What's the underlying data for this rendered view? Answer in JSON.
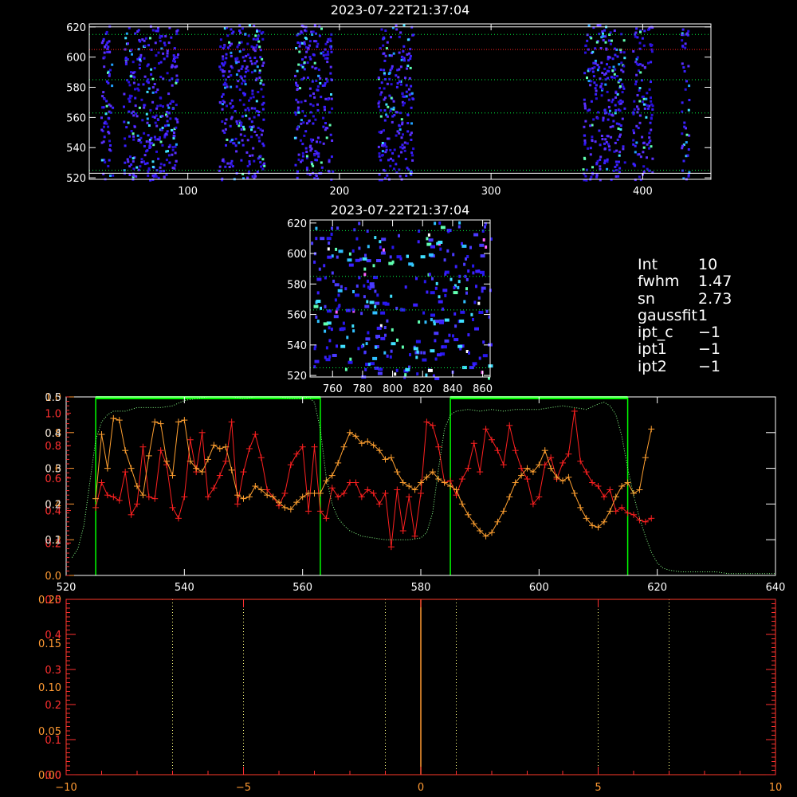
{
  "colors": {
    "background": "#000000",
    "axis": "#ffffff",
    "orange_axis": "#ff9a33",
    "red_axis": "#ff3030",
    "series_red": "#ff2020",
    "series_orange": "#ffa030",
    "profile": "#88ff88",
    "window": "#00ff00",
    "grid": "#00ff44",
    "grid_red": "#ff2020",
    "pixel_blue": "#3a20ff",
    "pixel_cyan": "#40e0ff"
  },
  "params": [
    {
      "key": "Int",
      "value": "10"
    },
    {
      "key": "fwhm",
      "value": "1.47"
    },
    {
      "key": "sn",
      "value": "2.73"
    },
    {
      "key": "gaussfit",
      "value": "1"
    },
    {
      "key": "ipt_c",
      "value": "−1"
    },
    {
      "key": "ipt1",
      "value": "−1"
    },
    {
      "key": "ipt2",
      "value": "−1"
    }
  ],
  "chart_data": [
    {
      "type": "heatmap",
      "title": "2023-07-22T21:37:04",
      "xlim": [
        35,
        445
      ],
      "ylim": [
        519,
        622
      ],
      "xticks": [
        100,
        200,
        300,
        400
      ],
      "yticks": [
        520,
        540,
        560,
        580,
        600,
        620
      ],
      "hlines_green": [
        525,
        563,
        585,
        615
      ],
      "hlines_red": [
        605
      ],
      "hlines_white": [
        523,
        620
      ],
      "bands": [
        [
          42,
          50
        ],
        [
          57,
          93
        ],
        [
          120,
          150
        ],
        [
          170,
          195
        ],
        [
          225,
          248
        ],
        [
          360,
          388
        ],
        [
          393,
          406
        ],
        [
          425,
          430
        ]
      ]
    },
    {
      "type": "heatmap",
      "title": "2023-07-22T21:37:04",
      "xlim": [
        745,
        865
      ],
      "ylim": [
        519,
        622
      ],
      "xticks": [
        760,
        780,
        800,
        820,
        840,
        860
      ],
      "yticks": [
        520,
        540,
        560,
        580,
        600,
        620
      ],
      "hlines_green": [
        525,
        563,
        585,
        615
      ]
    },
    {
      "type": "line",
      "xlim": [
        520,
        640
      ],
      "ylim": [
        0,
        1
      ],
      "xticks": [
        520,
        540,
        560,
        580,
        600,
        620,
        640
      ],
      "left_ticks_orange": [
        "0.0",
        "0.2",
        "0.4",
        "0.6",
        "0.8",
        "1.0"
      ],
      "left_ticks_red": [
        "0.2",
        "0.4",
        "0.6",
        "0.8",
        "1.0"
      ],
      "left_ticks_white": [
        "0.1",
        "0.2",
        "0.3",
        "0.4",
        "0.5"
      ],
      "windows": [
        [
          525,
          563
        ],
        [
          585,
          615
        ]
      ],
      "series": [
        {
          "color": "red",
          "x": [
            525,
            526,
            527,
            528,
            529,
            530,
            531,
            532,
            533,
            534,
            535,
            536,
            537,
            538,
            539,
            540,
            541,
            542,
            543,
            544,
            545,
            546,
            547,
            548,
            549,
            550,
            551,
            552,
            553,
            554,
            555,
            556,
            557,
            558,
            559,
            560,
            561,
            562,
            563,
            564,
            565,
            566,
            567,
            568,
            569,
            570,
            571,
            572,
            573,
            574,
            575,
            576,
            577,
            578,
            579,
            580,
            581,
            582,
            583,
            584,
            585,
            586,
            587,
            588,
            589,
            590,
            591,
            592,
            593,
            594,
            595,
            596,
            597,
            598,
            599,
            600,
            601,
            602,
            603,
            604,
            605,
            606,
            607,
            608,
            609,
            610,
            611,
            612,
            613,
            614,
            615,
            616,
            617,
            618,
            619
          ],
          "y": [
            0.38,
            0.52,
            0.45,
            0.44,
            0.42,
            0.58,
            0.34,
            0.4,
            0.72,
            0.44,
            0.43,
            0.7,
            0.62,
            0.38,
            0.32,
            0.44,
            0.76,
            0.58,
            0.8,
            0.44,
            0.49,
            0.56,
            0.64,
            0.86,
            0.4,
            0.58,
            0.71,
            0.79,
            0.66,
            0.48,
            0.44,
            0.39,
            0.46,
            0.62,
            0.68,
            0.72,
            0.36,
            0.72,
            0.36,
            0.32,
            0.49,
            0.44,
            0.46,
            0.52,
            0.52,
            0.44,
            0.48,
            0.46,
            0.4,
            0.46,
            0.16,
            0.48,
            0.25,
            0.44,
            0.22,
            0.46,
            0.86,
            0.84,
            0.72,
            0.52,
            0.53,
            0.45,
            0.54,
            0.6,
            0.74,
            0.58,
            0.82,
            0.76,
            0.7,
            0.62,
            0.84,
            0.7,
            0.6,
            0.54,
            0.4,
            0.44,
            0.62,
            0.66,
            0.54,
            0.63,
            0.68,
            0.92,
            0.64,
            0.58,
            0.52,
            0.5,
            0.44,
            0.48,
            0.36,
            0.38,
            0.35,
            0.34,
            0.31,
            0.3,
            0.32
          ],
          "name": ""
        },
        {
          "color": "orange",
          "x": [
            525,
            526,
            527,
            528,
            529,
            530,
            531,
            532,
            533,
            534,
            535,
            536,
            537,
            538,
            539,
            540,
            541,
            542,
            543,
            544,
            545,
            546,
            547,
            548,
            549,
            550,
            551,
            552,
            553,
            554,
            555,
            556,
            557,
            558,
            559,
            560,
            561,
            562,
            563,
            564,
            565,
            566,
            567,
            568,
            569,
            570,
            571,
            572,
            573,
            574,
            575,
            576,
            577,
            578,
            579,
            580,
            581,
            582,
            583,
            584,
            585,
            586,
            587,
            588,
            589,
            590,
            591,
            592,
            593,
            594,
            595,
            596,
            597,
            598,
            599,
            600,
            601,
            602,
            603,
            604,
            605,
            606,
            607,
            608,
            609,
            610,
            611,
            612,
            613,
            614,
            615,
            616,
            617,
            618,
            619
          ],
          "y": [
            0.43,
            0.79,
            0.6,
            0.88,
            0.87,
            0.7,
            0.6,
            0.5,
            0.45,
            0.67,
            0.86,
            0.85,
            0.64,
            0.56,
            0.86,
            0.87,
            0.64,
            0.6,
            0.58,
            0.65,
            0.73,
            0.71,
            0.72,
            0.59,
            0.45,
            0.43,
            0.44,
            0.5,
            0.48,
            0.45,
            0.44,
            0.41,
            0.38,
            0.37,
            0.41,
            0.44,
            0.46,
            0.46,
            0.46,
            0.53,
            0.56,
            0.63,
            0.72,
            0.8,
            0.78,
            0.74,
            0.75,
            0.73,
            0.7,
            0.65,
            0.66,
            0.58,
            0.52,
            0.5,
            0.48,
            0.52,
            0.55,
            0.58,
            0.54,
            0.52,
            0.5,
            0.48,
            0.4,
            0.34,
            0.29,
            0.25,
            0.22,
            0.24,
            0.3,
            0.36,
            0.44,
            0.52,
            0.56,
            0.6,
            0.58,
            0.62,
            0.7,
            0.6,
            0.55,
            0.53,
            0.55,
            0.46,
            0.38,
            0.32,
            0.28,
            0.27,
            0.3,
            0.36,
            0.44,
            0.5,
            0.52,
            0.46,
            0.48,
            0.66,
            0.82
          ],
          "name": ""
        },
        {
          "color": "profile",
          "x": [
            521,
            522,
            523,
            524,
            525,
            526,
            527,
            528,
            530,
            532,
            534,
            536,
            538,
            540,
            542,
            544,
            546,
            548,
            550,
            552,
            554,
            556,
            558,
            560,
            561,
            562,
            563,
            564,
            565,
            566,
            567,
            568,
            570,
            572,
            574,
            576,
            578,
            580,
            581,
            582,
            583,
            584,
            585,
            586,
            588,
            590,
            592,
            594,
            596,
            598,
            600,
            602,
            604,
            606,
            608,
            610,
            611,
            612,
            613,
            614,
            615,
            616,
            617,
            618,
            619,
            620,
            621,
            622,
            624,
            626,
            628,
            630,
            632,
            634,
            636,
            638,
            640
          ],
          "y": [
            0.1,
            0.15,
            0.28,
            0.52,
            0.76,
            0.86,
            0.9,
            0.92,
            0.92,
            0.94,
            0.94,
            0.94,
            0.95,
            0.98,
            0.99,
            1.0,
            1.0,
            1.0,
            0.99,
            1.0,
            1.0,
            1.0,
            0.99,
            0.99,
            1.0,
            0.97,
            0.82,
            0.55,
            0.4,
            0.32,
            0.28,
            0.25,
            0.22,
            0.21,
            0.2,
            0.2,
            0.2,
            0.21,
            0.24,
            0.35,
            0.6,
            0.82,
            0.9,
            0.92,
            0.93,
            0.92,
            0.93,
            0.92,
            0.93,
            0.93,
            0.93,
            0.94,
            0.95,
            0.94,
            0.93,
            0.96,
            0.97,
            0.95,
            0.9,
            0.78,
            0.6,
            0.45,
            0.32,
            0.22,
            0.13,
            0.07,
            0.04,
            0.03,
            0.02,
            0.02,
            0.02,
            0.02,
            0.01,
            0.01,
            0.01,
            0.01,
            0.01
          ],
          "name": ""
        }
      ]
    },
    {
      "type": "line",
      "xlim": [
        -10,
        10
      ],
      "ylim": [
        0,
        1
      ],
      "xticks": [
        -10,
        -5,
        0,
        5,
        10
      ],
      "left_ticks_orange": [
        "0.00",
        "0.05",
        "0.10",
        "0.15",
        "0.20"
      ],
      "left_ticks_red": [
        "0.0",
        "0.1",
        "0.2",
        "0.3",
        "0.4",
        "0.5"
      ],
      "vlines_yellow": [
        -7,
        -5,
        -1,
        1,
        5,
        7
      ],
      "vline_orange": 0
    }
  ]
}
